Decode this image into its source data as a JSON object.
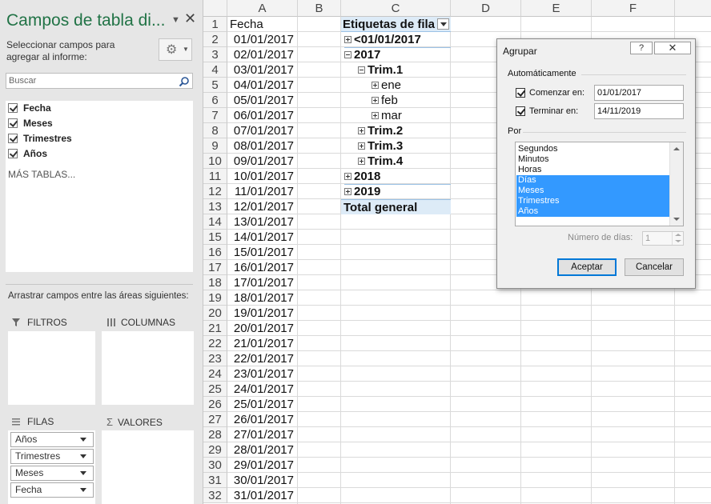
{
  "pane": {
    "title": "Campos de tabla di...",
    "description": "Seleccionar campos para agregar al informe:",
    "search_placeholder": "Buscar",
    "fields": [
      "Fecha",
      "Meses",
      "Trimestres",
      "Años"
    ],
    "more_tables": "MÁS TABLAS...",
    "areas_label": "Arrastrar campos entre las áreas siguientes:",
    "filters_label": "FILTROS",
    "columns_label": "COLUMNAS",
    "rows_label": "FILAS",
    "values_label": "VALORES",
    "row_fields": [
      "Años",
      "Trimestres",
      "Meses",
      "Fecha"
    ],
    "accent_color": "#217346"
  },
  "sheet": {
    "columns": [
      "A",
      "B",
      "C",
      "D",
      "E",
      "F"
    ],
    "rows": [
      "1",
      "2",
      "3",
      "4",
      "5",
      "6",
      "7",
      "8",
      "9",
      "10",
      "11",
      "12",
      "13",
      "14",
      "15",
      "16",
      "17",
      "18",
      "19",
      "20",
      "21",
      "22",
      "23",
      "24",
      "25",
      "26",
      "27",
      "28",
      "29",
      "30",
      "31",
      "32"
    ],
    "a1": "Fecha",
    "dates": [
      "01/01/2017",
      "02/01/2017",
      "03/01/2017",
      "04/01/2017",
      "05/01/2017",
      "06/01/2017",
      "07/01/2017",
      "08/01/2017",
      "09/01/2017",
      "10/01/2017",
      "11/01/2017",
      "12/01/2017",
      "13/01/2017",
      "14/01/2017",
      "15/01/2017",
      "16/01/2017",
      "17/01/2017",
      "18/01/2017",
      "19/01/2017",
      "20/01/2017",
      "21/01/2017",
      "22/01/2017",
      "23/01/2017",
      "24/01/2017",
      "25/01/2017",
      "26/01/2017",
      "27/01/2017",
      "28/01/2017",
      "29/01/2017",
      "30/01/2017",
      "31/01/2017"
    ],
    "pivot": {
      "header": "Etiquetas de fila",
      "items": [
        "<01/01/2017",
        "2017",
        "Trim.1",
        "ene",
        "feb",
        "mar",
        "Trim.2",
        "Trim.3",
        "Trim.4",
        "2018",
        "2019"
      ],
      "total": "Total general",
      "header_color": "#ddebf7"
    }
  },
  "dialog": {
    "title": "Agrupar",
    "help": "?",
    "auto_group": "Automáticamente",
    "start_label": "Comenzar en:",
    "start_value": "01/01/2017",
    "end_label": "Terminar en:",
    "end_value": "14/11/2019",
    "by_label": "Por",
    "options": [
      "Segundos",
      "Minutos",
      "Horas",
      "Días",
      "Meses",
      "Trimestres",
      "Años"
    ],
    "selected_options": [
      "Días",
      "Meses",
      "Trimestres",
      "Años"
    ],
    "days_label": "Número de días:",
    "days_value": "1",
    "ok": "Aceptar",
    "cancel": "Cancelar",
    "selection_color": "#3399ff"
  }
}
